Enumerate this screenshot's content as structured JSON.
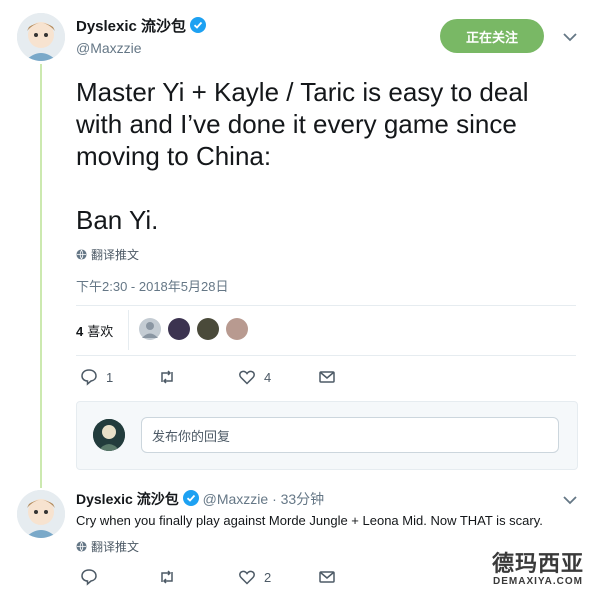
{
  "tweet": {
    "author_name": "Dyslexic 流沙包",
    "author_handle": "@Maxzzie",
    "follow_button": "正在关注",
    "text_lines": [
      "Master Yi + Kayle / Taric is easy to deal",
      "with and I’ve done it every game since",
      "moving to China:"
    ],
    "text_last": "Ban Yi.",
    "translate_label": "翻译推文",
    "timestamp": "下午2:30 - 2018年5月28日",
    "likes_number": "4",
    "likes_label": "喜欢",
    "actions": {
      "reply_count": "1",
      "retweet_count": "",
      "like_count": "4"
    }
  },
  "reply_composer": {
    "placeholder": "发布你的回复"
  },
  "reply": {
    "author_name": "Dyslexic 流沙包",
    "author_handle": "@Maxzzie",
    "time": "· 33分钟",
    "text": "Cry when you finally play against Morde Jungle + Leona Mid. Now THAT is scary.",
    "translate_label": "翻译推文",
    "actions": {
      "reply_count": "",
      "retweet_count": "",
      "like_count": "2"
    }
  },
  "watermark": {
    "title": "德玛西亚",
    "subtitle": "DEMAXIYA.COM"
  },
  "colors": {
    "follow_green": "#79b865",
    "thread_line": "#cce9b0",
    "verified_blue": "#1da1f2"
  }
}
